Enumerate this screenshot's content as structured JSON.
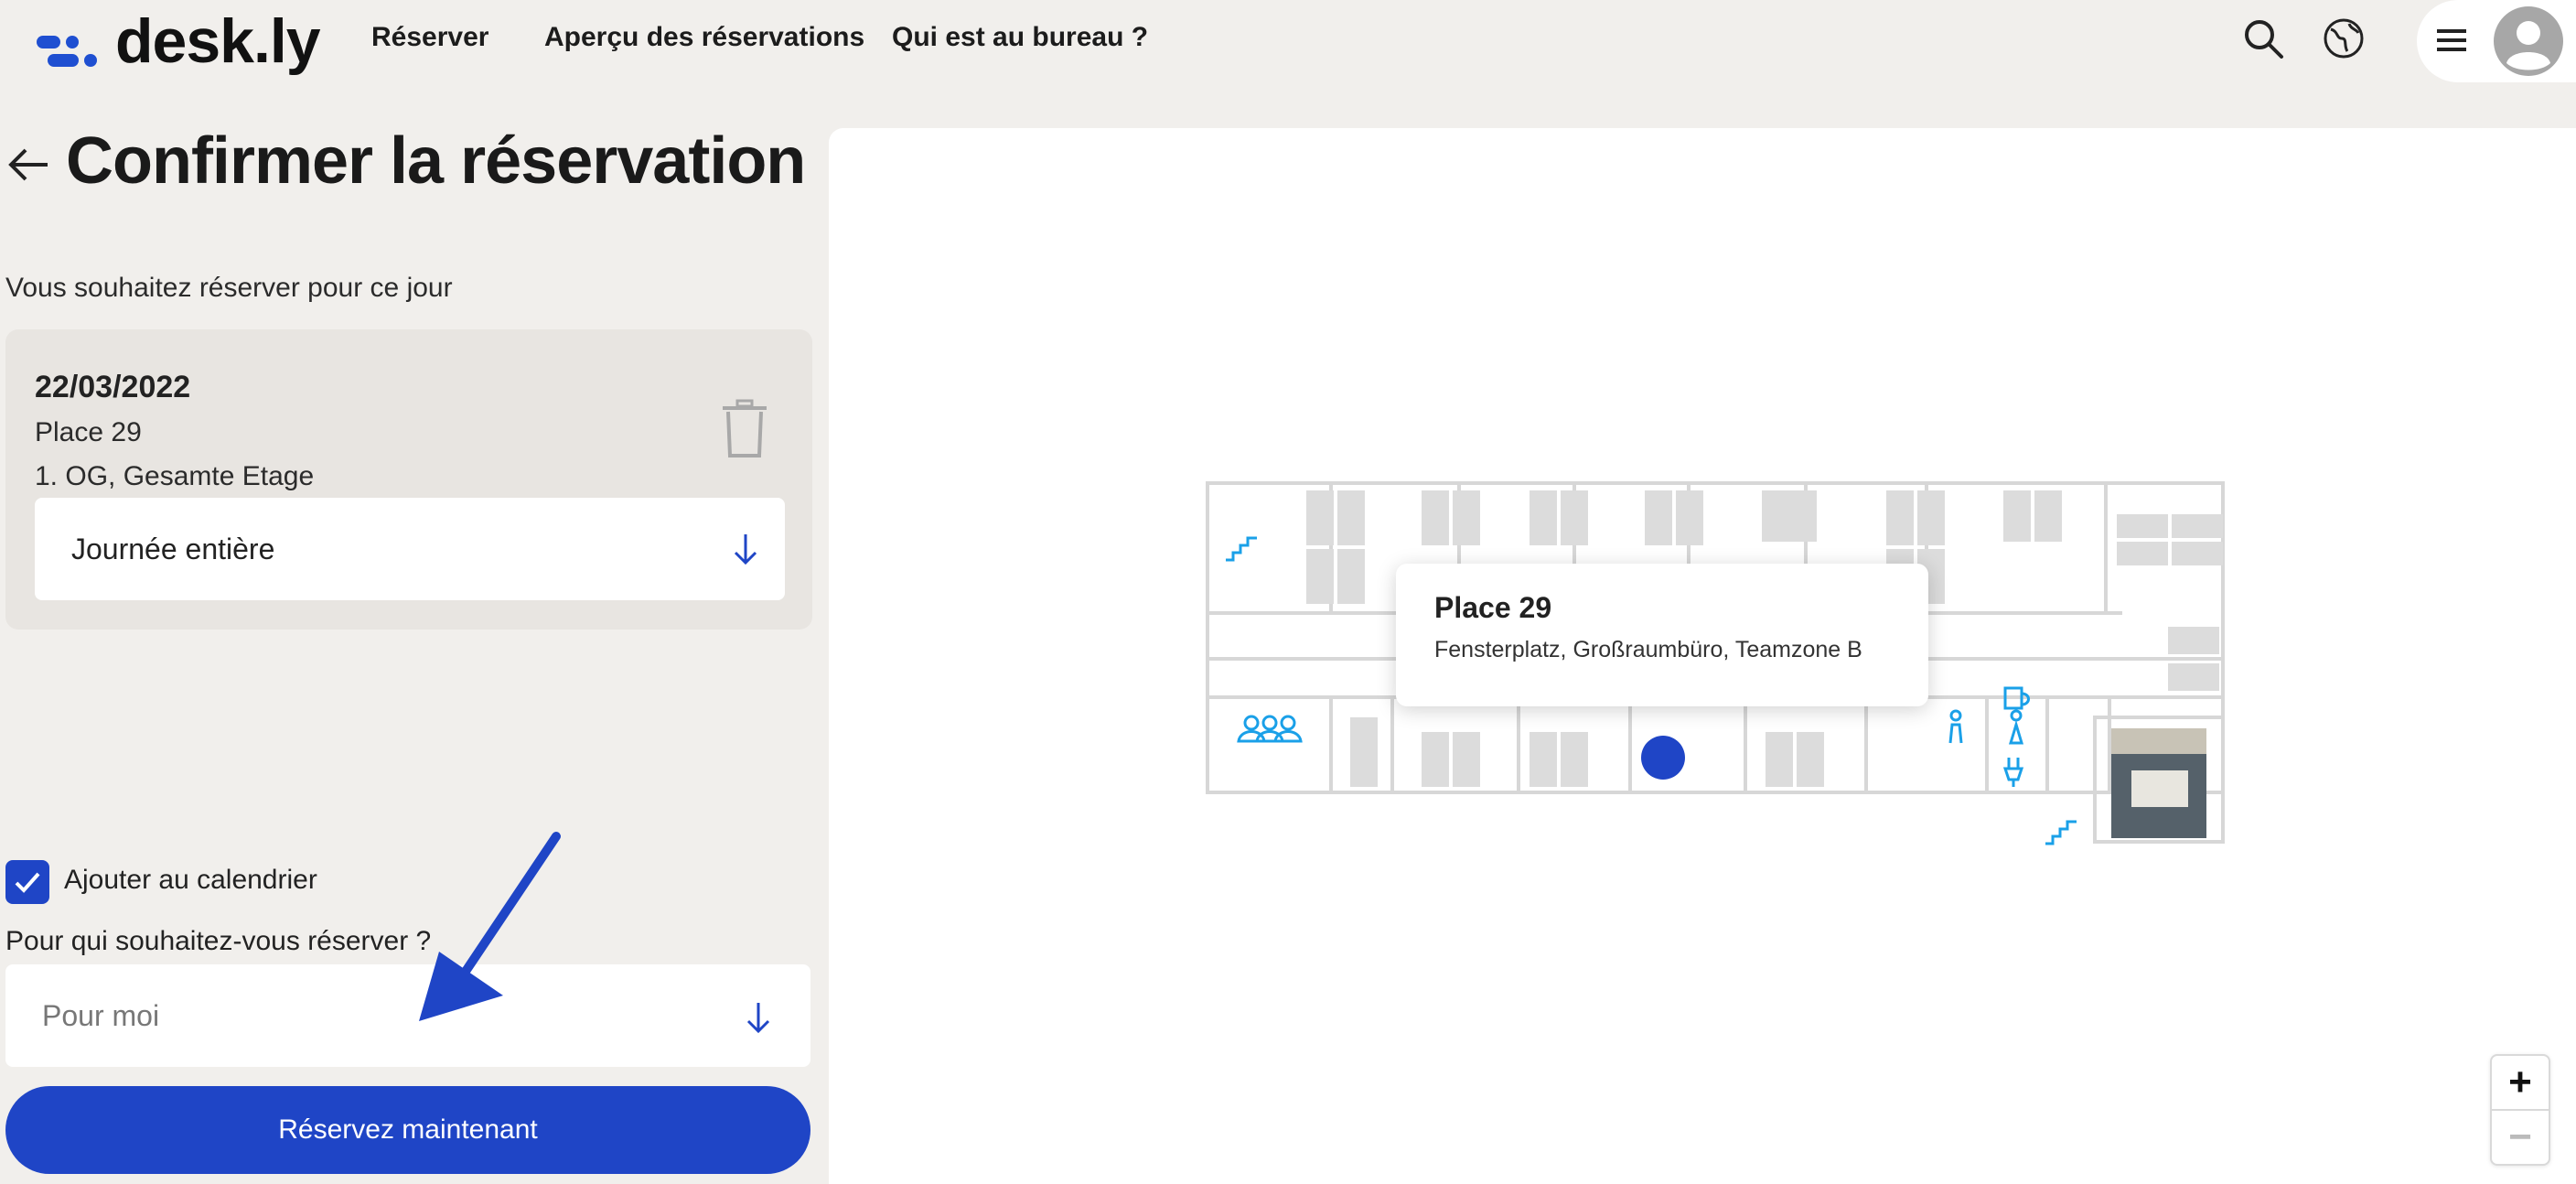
{
  "app": {
    "logo_text": "desk.ly"
  },
  "nav": {
    "items": [
      {
        "label": "Réserver"
      },
      {
        "label": "Aperçu des réservations"
      },
      {
        "label": "Qui est au bureau ?"
      }
    ],
    "icons": [
      "search-icon",
      "globe-icon",
      "menu-icon",
      "user-avatar-icon"
    ]
  },
  "page": {
    "title": "Confirmer la réservation",
    "subtitle": "Vous souhaitez réserver pour ce jour"
  },
  "booking": {
    "date": "22/03/2022",
    "place": "Place 29",
    "floor": "1. OG, Gesamte Etage",
    "duration_value": "Journée entière"
  },
  "calendar": {
    "label": "Ajouter au calendrier",
    "checked": true
  },
  "for_whom": {
    "label": "Pour qui souhaitez-vous réserver ?",
    "placeholder": "Pour moi"
  },
  "submit": {
    "label": "Réservez maintenant"
  },
  "map": {
    "tooltip": {
      "title": "Place 29",
      "subtitle": "Fensterplatz, Großraumbüro, Teamzone B"
    },
    "zoom_in": "+",
    "zoom_out": "−"
  },
  "colors": {
    "brand": "#1f45c6",
    "map_icon": "#1aa0e8",
    "background": "#f1efec"
  }
}
